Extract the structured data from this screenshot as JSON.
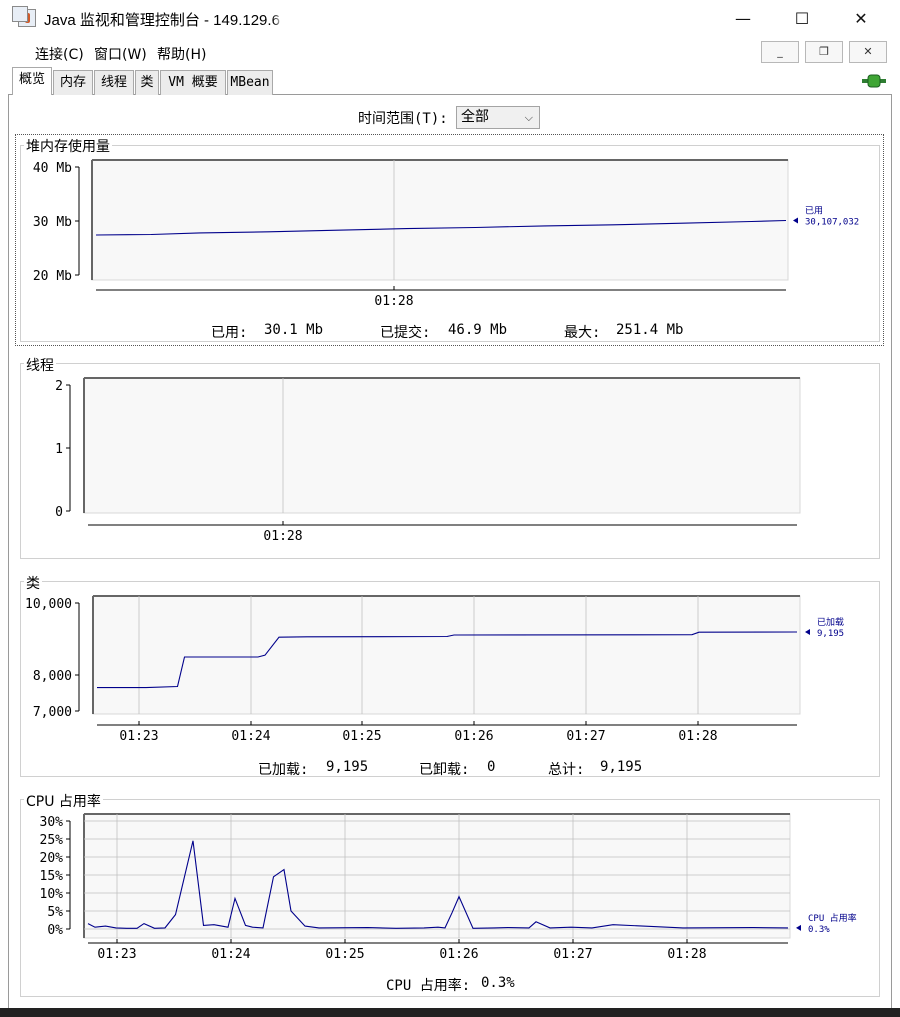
{
  "window": {
    "title": "Java 监视和管理控制台 - 149.129.6",
    "controls": {
      "minimize": "—",
      "maximize": "☐",
      "close": "✕"
    },
    "icon": "java-coffee-icon"
  },
  "menu": {
    "items": [
      "连接(C)",
      "窗口(W)",
      "帮助(H)"
    ],
    "mdi_controls": {
      "minimize": "_",
      "restore": "❐",
      "close": "✕"
    }
  },
  "tabs": [
    "概览",
    "内存",
    "线程",
    "类",
    "VM 概要",
    "MBean"
  ],
  "active_tab": "概览",
  "time_range": {
    "label": "时间范围(T):",
    "value": "全部"
  },
  "colors": {
    "series": "#00008b",
    "grid": "#c0c0c0",
    "plot_bg": "#f8f8f8",
    "connection": "#3fa535"
  },
  "panels": {
    "heap": {
      "title": "堆内存使用量",
      "y_ticks": [
        "40 Mb",
        "30 Mb",
        "20 Mb"
      ],
      "x_ticks": [
        "01:28"
      ],
      "legend_name": "已用",
      "legend_value": "30,107,032",
      "summary": [
        {
          "label": "已用:",
          "value": "30.1 Mb"
        },
        {
          "label": "已提交:",
          "value": "46.9 Mb"
        },
        {
          "label": "最大:",
          "value": "251.4 Mb"
        }
      ]
    },
    "threads": {
      "title": "线程",
      "y_ticks": [
        "2",
        "1",
        "0"
      ],
      "x_ticks": [
        "01:28"
      ]
    },
    "classes": {
      "title": "类",
      "y_ticks": [
        "10,000",
        "8,000",
        "7,000"
      ],
      "x_ticks": [
        "01:23",
        "01:24",
        "01:25",
        "01:26",
        "01:27",
        "01:28"
      ],
      "legend_name": "已加载",
      "legend_value": "9,195",
      "summary": [
        {
          "label": "已加载:",
          "value": "9,195"
        },
        {
          "label": "已卸载:",
          "value": "0"
        },
        {
          "label": "总计:",
          "value": "9,195"
        }
      ]
    },
    "cpu": {
      "title": "CPU 占用率",
      "y_ticks": [
        "30%",
        "25%",
        "20%",
        "15%",
        "10%",
        "5%",
        "0%"
      ],
      "x_ticks": [
        "01:23",
        "01:24",
        "01:25",
        "01:26",
        "01:27",
        "01:28"
      ],
      "legend_name": "CPU 占用率",
      "legend_value": "0.3%",
      "summary": [
        {
          "label": "CPU 占用率:",
          "value": "0.3%"
        }
      ]
    }
  },
  "chart_data": [
    {
      "type": "line",
      "title": "堆内存使用量",
      "ylim": [
        20,
        40
      ],
      "y_unit": "Mb",
      "series": [
        {
          "name": "已用",
          "x": [
            0,
            0.08,
            0.15,
            0.25,
            0.35,
            0.45,
            0.55,
            0.65,
            0.75,
            0.85,
            0.95,
            1.0
          ],
          "values": [
            27.4,
            27.5,
            27.8,
            28.0,
            28.3,
            28.6,
            28.8,
            29.1,
            29.3,
            29.6,
            29.9,
            30.1
          ]
        }
      ]
    },
    {
      "type": "line",
      "title": "线程",
      "ylim": [
        0,
        2
      ],
      "series": []
    },
    {
      "type": "line",
      "title": "类",
      "ylim": [
        7000,
        10000
      ],
      "series": [
        {
          "name": "已加载",
          "x": [
            0,
            0.07,
            0.115,
            0.125,
            0.135,
            0.175,
            0.23,
            0.24,
            0.26,
            0.3,
            0.5,
            0.51,
            0.85,
            0.86,
            1.0
          ],
          "values": [
            7650,
            7650,
            7680,
            8500,
            8500,
            8500,
            8500,
            8550,
            9050,
            9060,
            9070,
            9110,
            9120,
            9190,
            9195
          ]
        }
      ]
    },
    {
      "type": "line",
      "title": "CPU 占用率",
      "ylim": [
        0,
        30
      ],
      "y_unit": "%",
      "series": [
        {
          "name": "CPU 占用率",
          "x": [
            0,
            0.01,
            0.025,
            0.04,
            0.055,
            0.07,
            0.08,
            0.095,
            0.11,
            0.125,
            0.15,
            0.165,
            0.18,
            0.2,
            0.21,
            0.225,
            0.235,
            0.25,
            0.265,
            0.28,
            0.29,
            0.31,
            0.33,
            0.4,
            0.44,
            0.48,
            0.5,
            0.51,
            0.52,
            0.53,
            0.55,
            0.58,
            0.6,
            0.63,
            0.64,
            0.66,
            0.69,
            0.72,
            0.75,
            0.85,
            0.95,
            1.0
          ],
          "values": [
            1.5,
            0.5,
            0.8,
            0.3,
            0.2,
            0.2,
            1.5,
            0.2,
            0.3,
            4,
            24.5,
            1,
            1.2,
            0.5,
            8.5,
            1,
            0.5,
            0.3,
            14.5,
            16.5,
            5,
            0.8,
            0.3,
            0.4,
            0.2,
            0.3,
            0.5,
            0.3,
            4.5,
            9,
            0.2,
            0.3,
            0.4,
            0.3,
            2,
            0.3,
            0.5,
            0.3,
            1.2,
            0.3,
            0.4,
            0.3
          ]
        }
      ]
    }
  ]
}
